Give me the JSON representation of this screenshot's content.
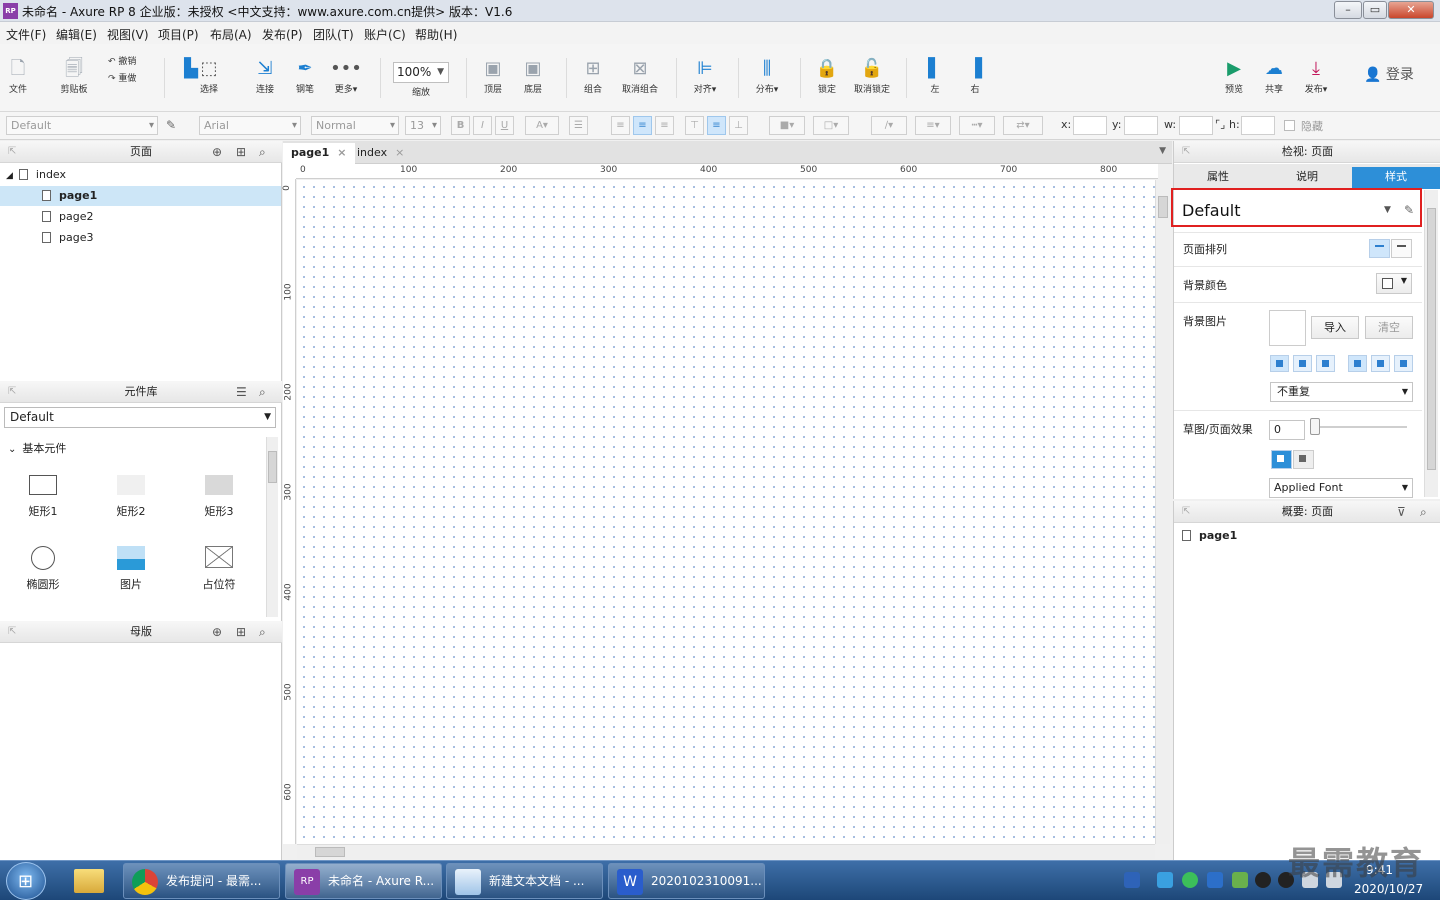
{
  "window": {
    "title": "未命名 - Axure RP 8 企业版：未授权      <中文支持：www.axure.com.cn提供> 版本：V1.6",
    "app_icon_text": "RP"
  },
  "menu": [
    "文件(F)",
    "编辑(E)",
    "视图(V)",
    "项目(P)",
    "布局(A)",
    "发布(P)",
    "团队(T)",
    "账户(C)",
    "帮助(H)"
  ],
  "toolbar": {
    "file": "文件",
    "clipboard": "剪贴板",
    "undo": "撤销",
    "redo": "重做",
    "select": "选择",
    "connect": "连接",
    "pen": "钢笔",
    "more": "更多▾",
    "zoom_value": "100%",
    "zoom": "缩放",
    "top": "顶层",
    "bottom": "底层",
    "group": "组合",
    "ungroup": "取消组合",
    "align": "对齐▾",
    "distribute": "分布▾",
    "lock": "锁定",
    "unlock": "取消锁定",
    "left": "左",
    "right": "右",
    "preview": "预览",
    "share": "共享",
    "publish": "发布▾",
    "login": "登录"
  },
  "format": {
    "style": "Default",
    "font": "Arial",
    "weight": "Normal",
    "size": "13",
    "x": "x:",
    "y": "y:",
    "w": "w:",
    "h": "h:",
    "hidden": "隐藏"
  },
  "pages": {
    "title": "页面",
    "root": "index",
    "items": [
      "page1",
      "page2",
      "page3"
    ],
    "selected": "page1"
  },
  "library": {
    "title": "元件库",
    "selected": "Default",
    "category": "基本元件",
    "widgets": [
      "矩形1",
      "矩形2",
      "矩形3",
      "椭圆形",
      "图片",
      "占位符"
    ]
  },
  "masters": {
    "title": "母版"
  },
  "canvas": {
    "tabs": [
      {
        "label": "page1",
        "close": "×"
      },
      {
        "label": "index",
        "close": "×"
      }
    ],
    "ruler_x": [
      "0",
      "100",
      "200",
      "300",
      "400",
      "500",
      "600",
      "700",
      "800"
    ],
    "ruler_y": [
      "0",
      "100",
      "200",
      "300",
      "400",
      "500",
      "600"
    ]
  },
  "inspector": {
    "title": "检视: 页面",
    "tabs": [
      "属性",
      "说明",
      "样式"
    ],
    "active_tab": "样式",
    "style_value": "Default",
    "page_align": "页面排列",
    "bg_color": "背景颜色",
    "bg_image": "背景图片",
    "import": "导入",
    "clear": "清空",
    "repeat": "不重复",
    "sketch": "草图/页面效果",
    "sketch_value": "0",
    "font": "Applied Font"
  },
  "outline": {
    "title": "概要: 页面",
    "item": "page1"
  },
  "taskbar": {
    "tasks": [
      "发布提问 - 最需...",
      "未命名 - Axure R...",
      "新建文本文档 - ...",
      "2020102310091..."
    ],
    "time": "9:41",
    "date": "2020/10/27",
    "watermark": "最需教育"
  },
  "colors": {
    "accent": "#1c7fd1",
    "highlight": "#e02020",
    "tab_active": "#2d8fd8"
  }
}
